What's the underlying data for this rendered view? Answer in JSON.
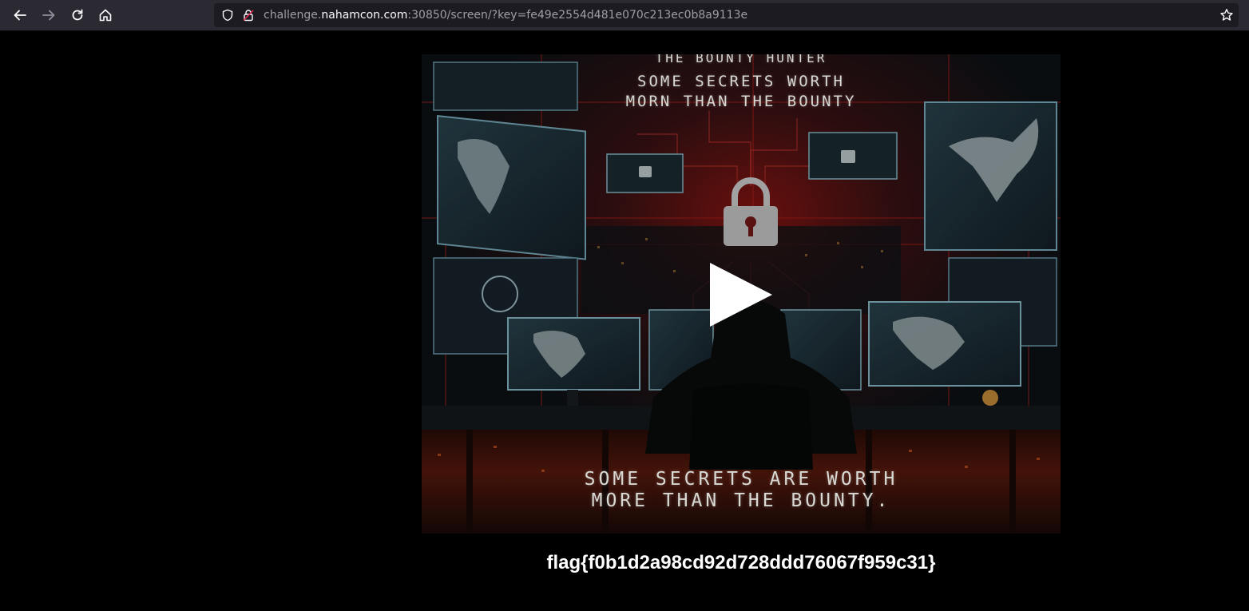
{
  "browser": {
    "url_prefix": "challenge.",
    "url_host": "nahamcon.com",
    "url_suffix": ":30850/screen/?key=fe49e2554d481e070c213ec0b8a9113e",
    "icons": [
      "back-arrow-icon",
      "forward-arrow-icon",
      "reload-icon",
      "home-icon",
      "shield-icon",
      "insecure-lock-icon",
      "bookmark-star-icon"
    ]
  },
  "video": {
    "poster_text": {
      "line1": "THE BOUNTY HUNTER",
      "line2": "SOME SECRETS  WORTH",
      "line3": "MORN THAN THE BOUNTY",
      "caption_line1": "SOME SECRETS ARE WORTH",
      "caption_line2": "MORE THAN THE BOUNTY."
    },
    "play_icon": "play-icon",
    "accent_color": "#e0241f"
  },
  "flag_text": "flag{f0b1d2a98cd92d728ddd76067f959c31}"
}
